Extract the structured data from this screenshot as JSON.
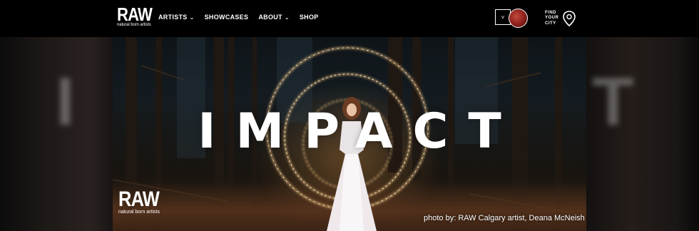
{
  "brand": {
    "name": "RAW",
    "tagline": "natural born artists"
  },
  "nav": [
    {
      "label": "ARTISTS",
      "has_menu": true
    },
    {
      "label": "SHOWCASES",
      "has_menu": false
    },
    {
      "label": "ABOUT",
      "has_menu": true
    },
    {
      "label": "SHOP",
      "has_menu": false
    }
  ],
  "account": {
    "chevron": "˅"
  },
  "find_city": {
    "line1": "FIND",
    "line2": "YOUR",
    "line3": "CITY",
    "icon": "map-pin-icon"
  },
  "hero": {
    "headline": "IMPACT",
    "ghost_left": "I",
    "ghost_right": "T",
    "badge": {
      "name": "RAW",
      "tagline": "natural born artists"
    },
    "credit": "photo by: RAW Calgary artist, Deana McNeish"
  },
  "colors": {
    "background": "#000000",
    "text": "#ffffff",
    "glow": "#ffb060"
  }
}
